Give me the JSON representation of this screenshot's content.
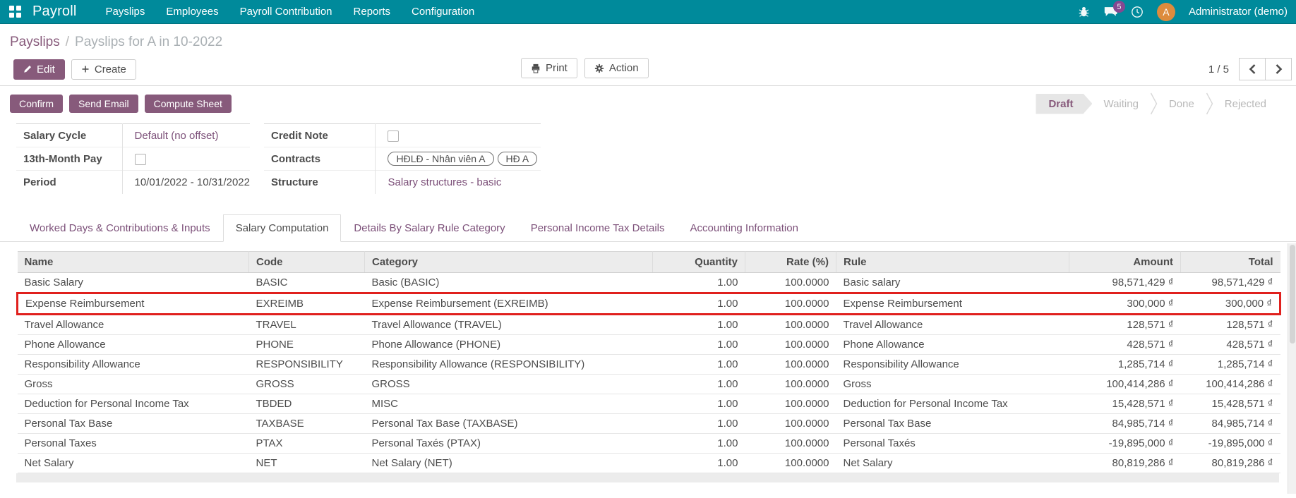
{
  "topbar": {
    "brand": "Payroll",
    "menus": [
      "Payslips",
      "Employees",
      "Payroll Contribution",
      "Reports",
      "Configuration"
    ],
    "message_badge": "5",
    "user_name": "Administrator (demo)",
    "avatar_letter": "A"
  },
  "breadcrumb": {
    "parent": "Payslips",
    "separator": "/",
    "current": "Payslips for A in 10-2022"
  },
  "controls": {
    "edit": "Edit",
    "create": "Create",
    "print": "Print",
    "action": "Action",
    "pager": "1 / 5"
  },
  "statusbar": {
    "buttons": [
      "Confirm",
      "Send Email",
      "Compute Sheet"
    ],
    "states": [
      "Draft",
      "Waiting",
      "Done",
      "Rejected"
    ],
    "active": "Draft"
  },
  "form": {
    "left": [
      {
        "label": "Salary Cycle",
        "type": "link",
        "value": "Default (no offset)"
      },
      {
        "label": "13th-Month Pay",
        "type": "checkbox",
        "checked": false
      },
      {
        "label": "Period",
        "type": "text",
        "value": "10/01/2022 - 10/31/2022"
      }
    ],
    "right": [
      {
        "label": "Credit Note",
        "type": "checkbox",
        "checked": false
      },
      {
        "label": "Contracts",
        "type": "tags",
        "tags": [
          "HĐLĐ - Nhân viên A",
          "HĐ A"
        ]
      },
      {
        "label": "Structure",
        "type": "link",
        "value": "Salary structures - basic"
      }
    ]
  },
  "tabs": {
    "items": [
      "Worked Days & Contributions & Inputs",
      "Salary Computation",
      "Details By Salary Rule Category",
      "Personal Income Tax Details",
      "Accounting Information"
    ],
    "active": "Salary Computation"
  },
  "table": {
    "columns": [
      {
        "label": "Name",
        "align": "left"
      },
      {
        "label": "Code",
        "align": "left"
      },
      {
        "label": "Category",
        "align": "left"
      },
      {
        "label": "Quantity",
        "align": "right"
      },
      {
        "label": "Rate (%)",
        "align": "right"
      },
      {
        "label": "Rule",
        "align": "left"
      },
      {
        "label": "Amount",
        "align": "right"
      },
      {
        "label": "Total",
        "align": "right"
      }
    ],
    "rows": [
      {
        "name": "Basic Salary",
        "code": "BASIC",
        "category": "Basic (BASIC)",
        "quantity": "1.00",
        "rate": "100.0000",
        "rule": "Basic salary",
        "amount": "98,571,429 ₫",
        "total": "98,571,429 ₫",
        "highlighted": false
      },
      {
        "name": "Expense Reimbursement",
        "code": "EXREIMB",
        "category": "Expense Reimbursement (EXREIMB)",
        "quantity": "1.00",
        "rate": "100.0000",
        "rule": "Expense Reimbursement",
        "amount": "300,000 ₫",
        "total": "300,000 ₫",
        "highlighted": true
      },
      {
        "name": "Travel Allowance",
        "code": "TRAVEL",
        "category": "Travel Allowance (TRAVEL)",
        "quantity": "1.00",
        "rate": "100.0000",
        "rule": "Travel Allowance",
        "amount": "128,571 ₫",
        "total": "128,571 ₫",
        "highlighted": false
      },
      {
        "name": "Phone Allowance",
        "code": "PHONE",
        "category": "Phone Allowance (PHONE)",
        "quantity": "1.00",
        "rate": "100.0000",
        "rule": "Phone Allowance",
        "amount": "428,571 ₫",
        "total": "428,571 ₫",
        "highlighted": false
      },
      {
        "name": "Responsibility Allowance",
        "code": "RESPONSIBILITY",
        "category": "Responsibility Allowance (RESPONSIBILITY)",
        "quantity": "1.00",
        "rate": "100.0000",
        "rule": "Responsibility Allowance",
        "amount": "1,285,714 ₫",
        "total": "1,285,714 ₫",
        "highlighted": false
      },
      {
        "name": "Gross",
        "code": "GROSS",
        "category": "GROSS",
        "quantity": "1.00",
        "rate": "100.0000",
        "rule": "Gross",
        "amount": "100,414,286 ₫",
        "total": "100,414,286 ₫",
        "highlighted": false
      },
      {
        "name": "Deduction for Personal Income Tax",
        "code": "TBDED",
        "category": "MISC",
        "quantity": "1.00",
        "rate": "100.0000",
        "rule": "Deduction for Personal Income Tax",
        "amount": "15,428,571 ₫",
        "total": "15,428,571 ₫",
        "highlighted": false
      },
      {
        "name": "Personal Tax Base",
        "code": "TAXBASE",
        "category": "Personal Tax Base (TAXBASE)",
        "quantity": "1.00",
        "rate": "100.0000",
        "rule": "Personal Tax Base",
        "amount": "84,985,714 ₫",
        "total": "84,985,714 ₫",
        "highlighted": false
      },
      {
        "name": "Personal Taxes",
        "code": "PTAX",
        "category": "Personal Taxés (PTAX)",
        "quantity": "1.00",
        "rate": "100.0000",
        "rule": "Personal Taxés",
        "amount": "-19,895,000 ₫",
        "total": "-19,895,000 ₫",
        "highlighted": false
      },
      {
        "name": "Net Salary",
        "code": "NET",
        "category": "Net Salary (NET)",
        "quantity": "1.00",
        "rate": "100.0000",
        "rule": "Net Salary",
        "amount": "80,819,286 ₫",
        "total": "80,819,286 ₫",
        "highlighted": false
      }
    ]
  },
  "colors": {
    "topbar": "#008a9b",
    "primary": "#875a7b",
    "link": "#7c5079",
    "highlight": "#e0201d",
    "avatar": "#dd8b3d",
    "badge": "#8d4591"
  }
}
